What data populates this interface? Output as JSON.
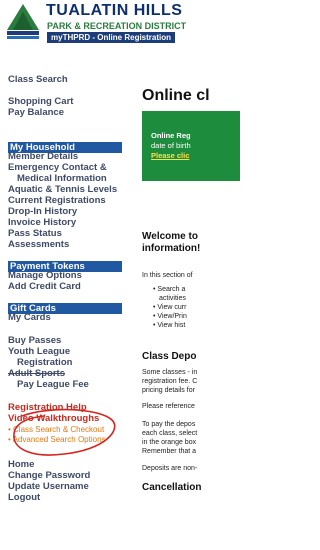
{
  "header": {
    "logo_name": "TUALATIN HILLS",
    "logo_sub": "PARK & RECREATION DISTRICT",
    "logo_tag": "myTHPRD - Online Registration"
  },
  "sidebar": {
    "class_search": "Class Search",
    "shopping_cart": "Shopping Cart",
    "pay_balance": "Pay Balance",
    "my_household": "My Household",
    "member_details": "Member Details",
    "emergency_contact": "Emergency Contact &",
    "medical_information": "Medical Information",
    "aquatic_tennis": "Aquatic & Tennis Levels",
    "current_registrations": "Current Registrations",
    "drop_in_history": "Drop-In History",
    "invoice_history": "Invoice History",
    "pass_status": "Pass Status",
    "assessments": "Assessments",
    "payment_tokens": "Payment Tokens",
    "manage_options": "Manage Options",
    "add_credit_card": "Add Credit Card",
    "gift_cards": "Gift Cards",
    "my_cards": "My Cards",
    "buy_passes": "Buy Passes",
    "youth_league": "Youth League",
    "registration": "Registration",
    "adult_sports": "Adult Sports",
    "pay_league_fee": "Pay League Fee",
    "registration_help": "Registration Help",
    "video_walkthroughs": "Video Walkthroughs",
    "video_class_search": "• Class Search & Checkout",
    "video_advanced_search": "• Advanced Search Options",
    "home": "Home",
    "change_password": "Change Password",
    "update_username": "Update Username",
    "logout": "Logout"
  },
  "content": {
    "title": "Online cl",
    "banner": {
      "line1": "Online Reg",
      "line2": "date of birth",
      "line3": "Please clic"
    },
    "welcome_l1": "Welcome to",
    "welcome_l2": "information!",
    "intro": "In this section of",
    "bullets": [
      "• Search a",
      "activities",
      "• View curr",
      "• View/Prin",
      "• View hist"
    ],
    "deposits_heading": "Class Depo",
    "deposits_p1": [
      "Some classes - in",
      "registration fee. C",
      "pricing details for"
    ],
    "deposits_p2": "Please reference",
    "deposits_p3": [
      "To pay the depos",
      "each class, select",
      "in the orange box",
      "Remember that a"
    ],
    "deposits_p4": "Deposits are non-",
    "cancellation_heading": "Cancellation"
  },
  "colors": {
    "section_bg": "#2158a2",
    "banner_bg": "#1d8c3c",
    "brand_navy": "#0d2f6e",
    "highlight_red": "#c62a1e"
  }
}
